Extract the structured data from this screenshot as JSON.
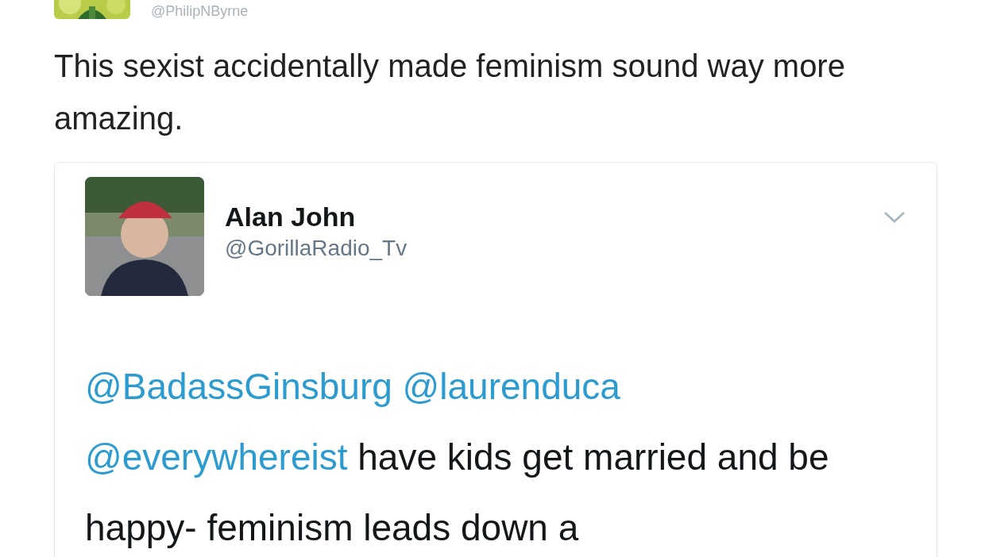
{
  "tweet": {
    "handle": "@PhilipNByrne",
    "text": "This sexist accidentally made feminism sound way more amazing.",
    "quoted_tweet": {
      "name": "Alan John",
      "handle": "@GorillaRadio_Tv",
      "body": [
        {
          "kind": "mention",
          "text": "@BadassGinsburg"
        },
        {
          "kind": "mention",
          "text": "@laurenduca"
        },
        {
          "kind": "mention",
          "text": "@everywhereist"
        },
        {
          "kind": "text",
          "text": "have kids get married and be happy- feminism leads down a"
        }
      ]
    }
  }
}
